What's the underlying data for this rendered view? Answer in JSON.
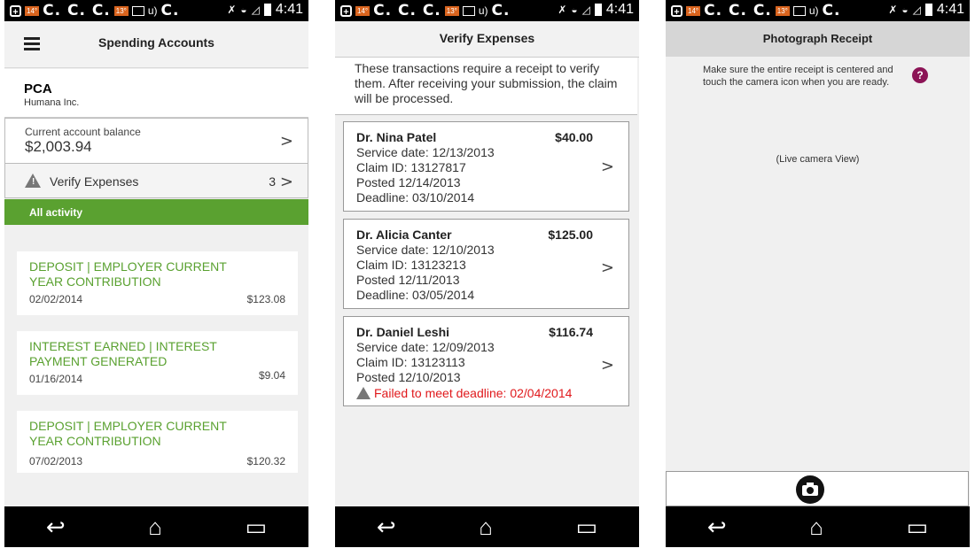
{
  "status_bar": {
    "left_text": "C. C. C.",
    "badge1": "14°",
    "badge2": "13°",
    "mid_text": "C.",
    "time": "4:41"
  },
  "screen1": {
    "title": "Spending Accounts",
    "account": {
      "name": "PCA",
      "employer": "Humana Inc."
    },
    "balance": {
      "label": "Current account balance",
      "value": "$2,003.94"
    },
    "verify": {
      "label": "Verify Expenses",
      "count": "3"
    },
    "activity_header": "All activity",
    "activities": [
      {
        "title": "DEPOSIT | EMPLOYER CURRENT YEAR CONTRIBUTION",
        "date": "02/02/2014",
        "amount": "$123.08"
      },
      {
        "title": "INTEREST EARNED | INTEREST PAYMENT GENERATED",
        "date": "01/16/2014",
        "amount": "$9.04"
      },
      {
        "title": "DEPOSIT | EMPLOYER CURRENT YEAR CONTRIBUTION",
        "date": "07/02/2013",
        "amount": "$120.32"
      }
    ]
  },
  "screen2": {
    "title": "Verify Expenses",
    "intro": "These transactions require a receipt to verify them. After receiving your submission, the claim will be processed.",
    "expenses": [
      {
        "doctor": "Dr. Nina Patel",
        "amount": "$40.00",
        "service": "Service date:  12/13/2013",
        "claim": "Claim ID:  13127817",
        "posted": "Posted 12/14/2013",
        "deadline": "Deadline:  03/10/2014"
      },
      {
        "doctor": "Dr. Alicia Canter",
        "amount": "$125.00",
        "service": "Service date:  12/10/2013",
        "claim": "Claim ID:  13123213",
        "posted": "Posted 12/11/2013",
        "deadline": "Deadline:  03/05/2014"
      },
      {
        "doctor": "Dr. Daniel Leshi",
        "amount": "$116.74",
        "service": "Service date:  12/09/2013",
        "claim": "Claim ID:  13123113",
        "posted": "Posted 12/10/2013",
        "failed": "Failed to meet deadline: 02/04/2014"
      }
    ]
  },
  "screen3": {
    "title": "Photograph Receipt",
    "instructions": "Make sure the entire receipt is centered and touch the camera icon when you are ready.",
    "help": "?",
    "live_view": "(Live camera View)"
  },
  "nav": {
    "back": "↩",
    "home": "⌂",
    "recents": "▭"
  },
  "chevron": ">",
  "colors": {
    "green": "#5aa130",
    "error": "#e0191c",
    "help": "#8c1456"
  }
}
